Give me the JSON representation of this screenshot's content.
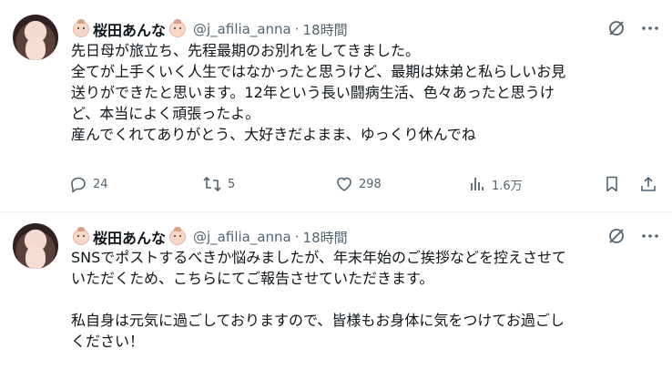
{
  "tweets": [
    {
      "display_name": "桜田あんな",
      "handle": "@j_afilia_anna",
      "separator": "·",
      "time": "18時間",
      "lines": [
        "先日母が旅立ち、先程最期のお別れをしてきました。",
        "全てが上手くいく人生ではなかったと思うけど、最期は妹弟と私らしいお見",
        "送りができたと思います。12年という長い闘病生活、色々あったと思うけ",
        "ど、本当によく頑張ったよ。",
        "産んでくれてありがとう、大好きだよまま、ゆっくり休んでね"
      ],
      "replies": "24",
      "reposts": "5",
      "likes": "298",
      "views": "1.6万"
    },
    {
      "display_name": "桜田あんな",
      "handle": "@j_afilia_anna",
      "separator": "·",
      "time": "18時間",
      "lines": [
        "SNSでポストするべきか悩みましたが、年末年始のご挨拶などを控えさせて",
        "いただくため、こちらにてご報告させていただきます。",
        "",
        "私自身は元気に過ごしておりますので、皆様もお身体に気をつけてお過ごし",
        "ください！"
      ]
    }
  ],
  "icons": {
    "reply": "reply-icon",
    "repost": "repost-icon",
    "like": "heart-icon",
    "views": "views-icon",
    "bookmark": "bookmark-icon",
    "share": "share-icon",
    "grok": "slash-circle-icon",
    "more": "more-icon"
  }
}
